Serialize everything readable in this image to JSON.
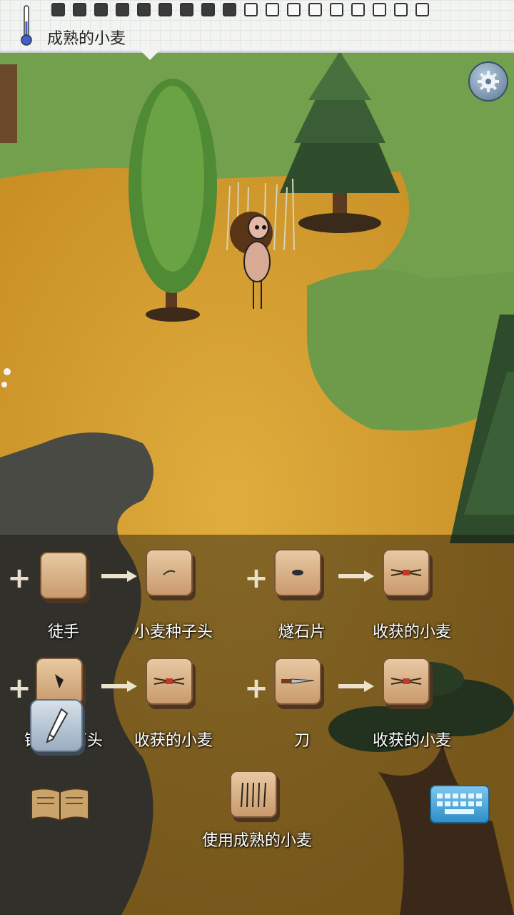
{
  "hud": {
    "hover_label": "成熟的小麦",
    "tool_slots_total": 18,
    "tool_slots_filled": 9
  },
  "recipes": [
    {
      "tool": "徒手",
      "result": "小麦种子头",
      "tool_icon": "empty-hand-icon",
      "result_icon": "wheat-seed-head-icon"
    },
    {
      "tool": "燧石片",
      "result": "收获的小麦",
      "tool_icon": "flint-chip-icon",
      "result_icon": "harvested-wheat-icon"
    },
    {
      "tool": "锋利的石头",
      "result": "收获的小麦",
      "tool_icon": "sharp-stone-icon",
      "result_icon": "harvested-wheat-icon"
    },
    {
      "tool": "刀",
      "result": "收获的小麦",
      "tool_icon": "knife-icon",
      "result_icon": "harvested-wheat-icon"
    }
  ],
  "use_action": {
    "label": "使用成熟的小麦",
    "icon": "ripe-wheat-icon"
  },
  "colors": {
    "card": "#d9b48a",
    "label": "#ffffff",
    "grass": "#6f9a4a",
    "wheat": "#d9a53a"
  }
}
